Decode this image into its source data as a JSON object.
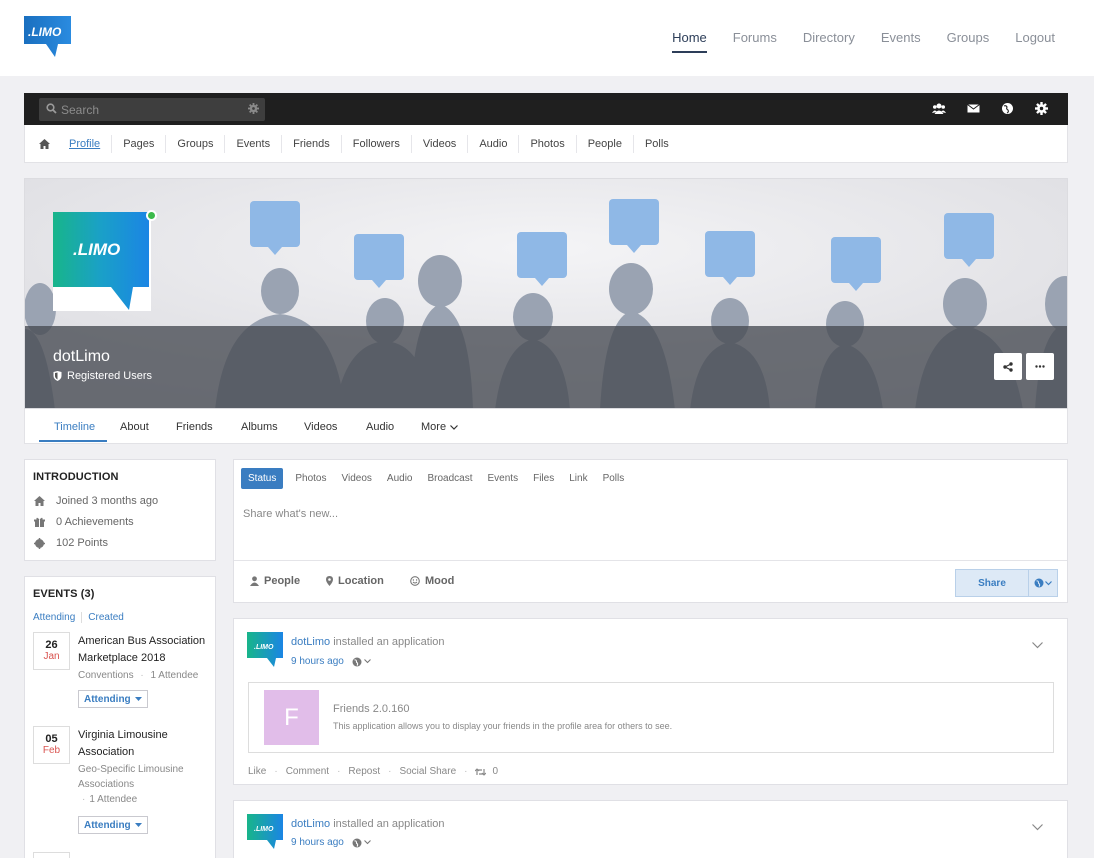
{
  "brand": {
    "logo_text": ".LIMO",
    "accent": "#3a7dc1",
    "logo_green": "#1bb57a",
    "logo_blue": "#1a8de0"
  },
  "main_nav": [
    {
      "label": "Home",
      "active": true
    },
    {
      "label": "Forums"
    },
    {
      "label": "Directory"
    },
    {
      "label": "Events"
    },
    {
      "label": "Groups"
    },
    {
      "label": "Logout"
    }
  ],
  "toolbar": {
    "search_placeholder": "Search",
    "icons": [
      "users-icon",
      "envelope-icon",
      "globe-icon",
      "gear-icon"
    ]
  },
  "sub_nav": [
    "Profile",
    "Pages",
    "Groups",
    "Events",
    "Friends",
    "Followers",
    "Videos",
    "Audio",
    "Photos",
    "People",
    "Polls"
  ],
  "profile": {
    "name": "dotLimo",
    "role": "Registered Users",
    "online": true
  },
  "profile_tabs": [
    "Timeline",
    "About",
    "Friends",
    "Albums",
    "Videos",
    "Audio",
    "More"
  ],
  "intro": {
    "title": "INTRODUCTION",
    "rows": [
      {
        "icon": "home-icon",
        "text": "Joined 3 months ago"
      },
      {
        "icon": "gift-icon",
        "text": "0 Achievements"
      },
      {
        "icon": "star-icon",
        "text": "102 Points"
      }
    ]
  },
  "events": {
    "title": "EVENTS (3)",
    "tabs": [
      "Attending",
      "Created"
    ],
    "items": [
      {
        "day": "26",
        "month": "Jan",
        "title": "American Bus Association Marketplace 2018",
        "category": "Conventions",
        "attendees": "1 Attendee",
        "rsvp": "Attending"
      },
      {
        "day": "05",
        "month": "Feb",
        "title": "Virginia Limousine Association",
        "category": "Geo-Specific Limousine Associations",
        "attendees": "1 Attendee",
        "rsvp": "Attending"
      }
    ]
  },
  "composer": {
    "tabs": [
      "Status",
      "Photos",
      "Videos",
      "Audio",
      "Broadcast",
      "Events",
      "Files",
      "Link",
      "Polls"
    ],
    "placeholder": "Share what's new...",
    "people": "People",
    "location": "Location",
    "mood": "Mood",
    "share": "Share"
  },
  "feed": [
    {
      "user": "dotLimo",
      "action": "installed an application",
      "time": "9 hours ago",
      "app_letter": "F",
      "app_name": "Friends 2.0.160",
      "app_desc": "This application allows you to display your friends in the profile area for others to see.",
      "actions": [
        "Like",
        "Comment",
        "Repost",
        "Social Share"
      ],
      "repost_count": "0"
    },
    {
      "user": "dotLimo",
      "action": "installed an application",
      "time": "9 hours ago"
    }
  ]
}
